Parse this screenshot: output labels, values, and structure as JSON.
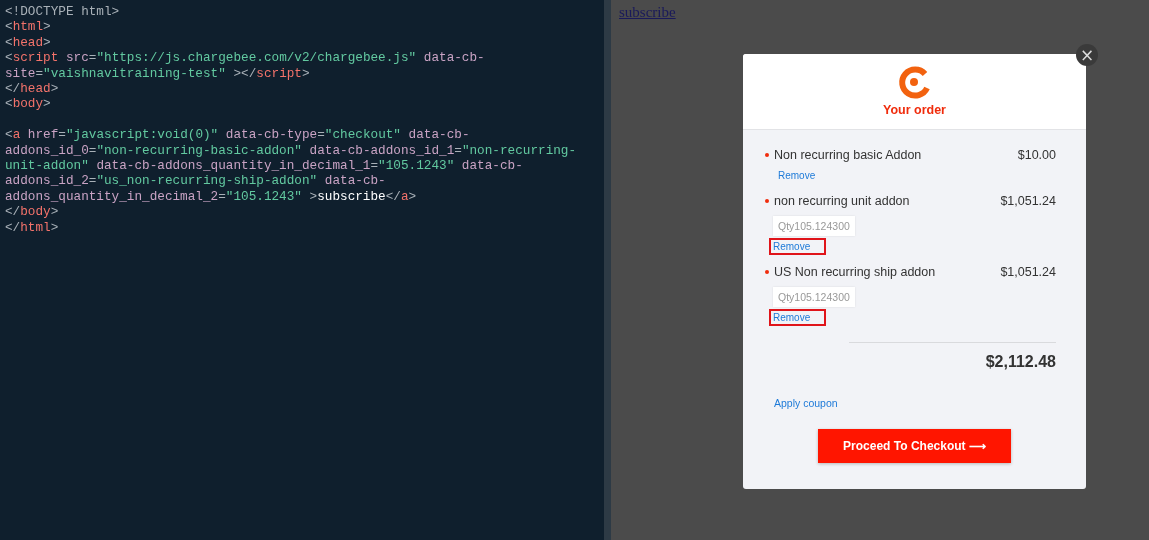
{
  "editor": {
    "lines": [
      {
        "tokens": [
          {
            "kind": "doctype",
            "t": "<!DOCTYPE html>"
          }
        ]
      },
      {
        "tokens": [
          {
            "kind": "punct",
            "t": "<"
          },
          {
            "kind": "tag",
            "t": "html"
          },
          {
            "kind": "punct",
            "t": ">"
          }
        ]
      },
      {
        "tokens": [
          {
            "kind": "punct",
            "t": "<"
          },
          {
            "kind": "tag",
            "t": "head"
          },
          {
            "kind": "punct",
            "t": ">"
          }
        ]
      },
      {
        "tokens": [
          {
            "kind": "punct",
            "t": "<"
          },
          {
            "kind": "tag",
            "t": "script"
          },
          {
            "kind": "attr",
            "t": " src"
          },
          {
            "kind": "punct",
            "t": "="
          },
          {
            "kind": "string",
            "t": "\"https://js.chargebee.com/v2/chargebee.js\""
          },
          {
            "kind": "attr",
            "t": " data-cb-"
          }
        ]
      },
      {
        "tokens": [
          {
            "kind": "attr",
            "t": "site"
          },
          {
            "kind": "punct",
            "t": "="
          },
          {
            "kind": "string",
            "t": "\"vaishnavitraining-test\""
          },
          {
            "kind": "punct",
            "t": " ></"
          },
          {
            "kind": "tag",
            "t": "script"
          },
          {
            "kind": "punct",
            "t": ">"
          }
        ]
      },
      {
        "tokens": [
          {
            "kind": "punct",
            "t": "</"
          },
          {
            "kind": "tag",
            "t": "head"
          },
          {
            "kind": "punct",
            "t": ">"
          }
        ]
      },
      {
        "tokens": [
          {
            "kind": "punct",
            "t": "<"
          },
          {
            "kind": "tag",
            "t": "body"
          },
          {
            "kind": "punct",
            "t": ">"
          }
        ]
      },
      {
        "spaced": true,
        "tokens": [
          {
            "kind": "punct",
            "t": "<"
          },
          {
            "kind": "tag",
            "t": "a"
          },
          {
            "kind": "attr",
            "t": " href"
          },
          {
            "kind": "punct",
            "t": "="
          },
          {
            "kind": "string",
            "t": "\"javascript:void(0)\""
          },
          {
            "kind": "attr",
            "t": " data-cb-type"
          },
          {
            "kind": "punct",
            "t": "="
          },
          {
            "kind": "string",
            "t": "\"checkout\""
          },
          {
            "kind": "attr",
            "t": " data-cb-"
          }
        ]
      },
      {
        "tokens": [
          {
            "kind": "attr",
            "t": "addons_id_0"
          },
          {
            "kind": "punct",
            "t": "="
          },
          {
            "kind": "string",
            "t": "\"non-recurring-basic-addon\""
          },
          {
            "kind": "attr",
            "t": " data-cb-addons_id_1"
          },
          {
            "kind": "punct",
            "t": "="
          },
          {
            "kind": "string",
            "t": "\"non-recurring-"
          }
        ]
      },
      {
        "tokens": [
          {
            "kind": "string",
            "t": "unit-addon\""
          },
          {
            "kind": "attr",
            "t": " data-cb-addons_quantity_in_decimal_1"
          },
          {
            "kind": "punct",
            "t": "="
          },
          {
            "kind": "string",
            "t": "\"105.1243\""
          },
          {
            "kind": "attr",
            "t": " data-cb-"
          }
        ]
      },
      {
        "tokens": [
          {
            "kind": "attr",
            "t": "addons_id_2"
          },
          {
            "kind": "punct",
            "t": "="
          },
          {
            "kind": "string",
            "t": "\"us_non-recurring-ship-addon\""
          },
          {
            "kind": "attr",
            "t": " data-cb-"
          }
        ]
      },
      {
        "tokens": [
          {
            "kind": "attr",
            "t": "addons_quantity_in_decimal_2"
          },
          {
            "kind": "punct",
            "t": "="
          },
          {
            "kind": "string",
            "t": "\"105.1243\""
          },
          {
            "kind": "punct",
            "t": " >"
          },
          {
            "kind": "text",
            "t": "subscribe"
          },
          {
            "kind": "punct",
            "t": "</"
          },
          {
            "kind": "tag",
            "t": "a"
          },
          {
            "kind": "punct",
            "t": ">"
          }
        ]
      },
      {
        "tokens": [
          {
            "kind": "punct",
            "t": "</"
          },
          {
            "kind": "tag",
            "t": "body"
          },
          {
            "kind": "punct",
            "t": ">"
          }
        ]
      },
      {
        "tokens": [
          {
            "kind": "punct",
            "t": "</"
          },
          {
            "kind": "tag",
            "t": "html"
          },
          {
            "kind": "punct",
            "t": ">"
          }
        ]
      }
    ]
  },
  "preview": {
    "link": "subscribe"
  },
  "modal": {
    "close": "×",
    "title": "Your order",
    "items": [
      {
        "name": "Non recurring basic Addon",
        "price": "$10.00",
        "remove": "Remove",
        "highlighted": false
      },
      {
        "name": "non recurring unit addon",
        "price": "$1,051.24",
        "qty": "Qty105.124300",
        "remove": "Remove",
        "highlighted": true
      },
      {
        "name": "US Non recurring ship addon",
        "price": "$1,051.24",
        "qty": "Qty105.124300",
        "remove": "Remove",
        "highlighted": true
      }
    ],
    "total": "$2,112.48",
    "coupon": "Apply coupon",
    "checkout": "Proceed To Checkout ⟶"
  }
}
